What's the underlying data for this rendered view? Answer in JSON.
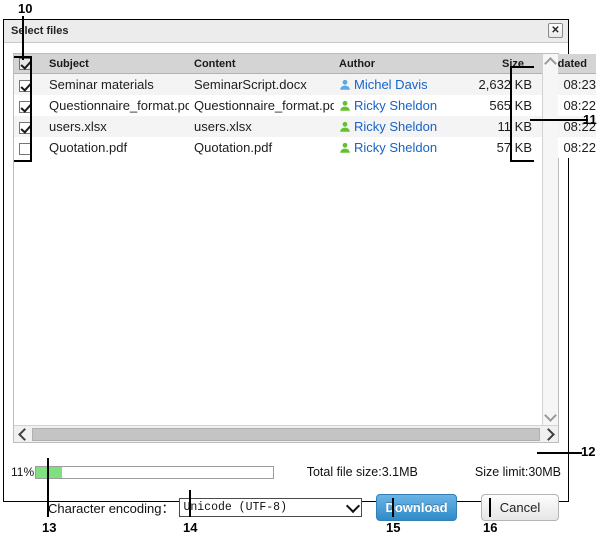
{
  "dialog": {
    "title": "Select files",
    "close_label": "✕"
  },
  "filelist": {
    "columns": {
      "subject": "Subject",
      "content": "Content",
      "author": "Author",
      "size": "Size",
      "updated": "Updated"
    },
    "select_all_checked": true,
    "rows": [
      {
        "checked": true,
        "subject": "Seminar materials",
        "content": "SeminarScript.docx",
        "author": "Michel Davis",
        "author_icon_color": "#5aa9e6",
        "size": "2,632 KB",
        "updated": "08:23"
      },
      {
        "checked": true,
        "subject": "Questionnaire_format.pdf",
        "content": "Questionnaire_format.pdf",
        "author": "Ricky Sheldon",
        "author_icon_color": "#63c22c",
        "size": "565 KB",
        "updated": "08:22"
      },
      {
        "checked": true,
        "subject": "users.xlsx",
        "content": "users.xlsx",
        "author": "Ricky Sheldon",
        "author_icon_color": "#63c22c",
        "size": "11 KB",
        "updated": "08:22"
      },
      {
        "checked": false,
        "subject": "Quotation.pdf",
        "content": "Quotation.pdf",
        "author": "Ricky Sheldon",
        "author_icon_color": "#63c22c",
        "size": "57 KB",
        "updated": "08:22"
      }
    ]
  },
  "progress": {
    "percent_label": "11%",
    "percent_value": 11,
    "total_file_size": "Total file size:3.1MB",
    "size_limit": "Size limit:30MB",
    "fill_color": "#7ee07e"
  },
  "controls": {
    "encoding_label": "Character encoding：",
    "encoding_value": "Unicode  (UTF-8)",
    "download_label": "Download",
    "cancel_label": "Cancel",
    "download_color": "#2f8bc9"
  },
  "annotations": {
    "n10": "10",
    "n11": "11",
    "n12": "12",
    "n13": "13",
    "n14": "14",
    "n15": "15",
    "n16": "16"
  }
}
